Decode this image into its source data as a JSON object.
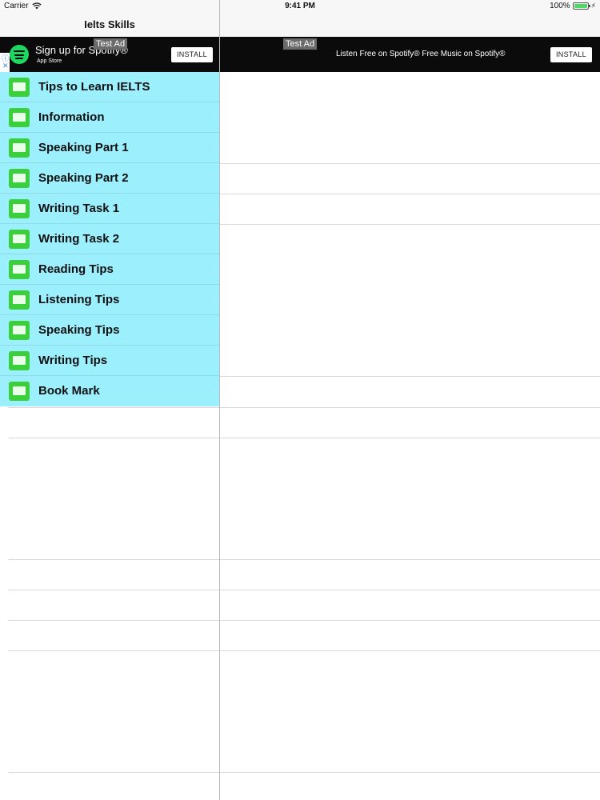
{
  "status_bar": {
    "carrier": "Carrier",
    "time": "9:41 PM",
    "battery": "100%",
    "icons": [
      "wifi-icon",
      "battery-icon",
      "charging-icon"
    ]
  },
  "nav": {
    "title": "Ielts Skills"
  },
  "ad_left": {
    "tag": "Test Ad",
    "title": "Sign up for Spotify®",
    "store": "App Store",
    "install": "INSTALL"
  },
  "ad_right": {
    "tag": "Test Ad",
    "text": "Listen Free on Spotify® Free Music on Spotify®",
    "install": "INSTALL"
  },
  "menu": {
    "items": [
      {
        "label": "Tips to Learn IELTS"
      },
      {
        "label": "Information"
      },
      {
        "label": "Speaking Part 1"
      },
      {
        "label": "Speaking Part 2"
      },
      {
        "label": "Writing Task 1"
      },
      {
        "label": "Writing Task 2"
      },
      {
        "label": "Reading Tips"
      },
      {
        "label": "Listening Tips"
      },
      {
        "label": "Speaking Tips"
      },
      {
        "label": "Writing Tips"
      },
      {
        "label": "Book Mark"
      }
    ]
  },
  "colors": {
    "menu_bg": "#9ceffd",
    "icon_green": "#3bcf3b",
    "ad_bg": "#0b0b0b",
    "spotify_green": "#1ed760"
  }
}
